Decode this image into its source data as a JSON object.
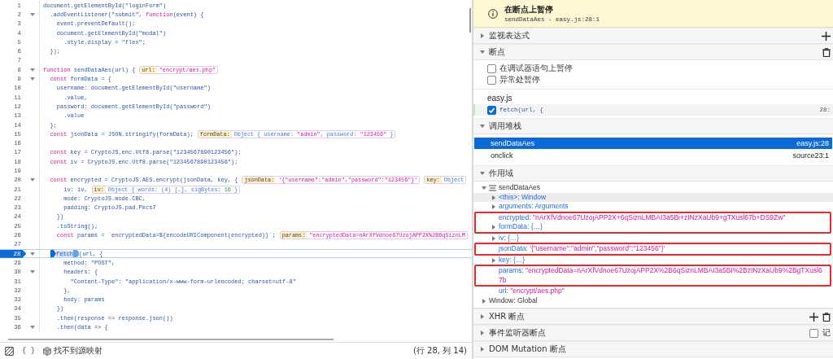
{
  "editor": {
    "lines": [
      {
        "number": "1",
        "fold": false,
        "current": false,
        "code": [
          {
            "kind": "v",
            "text": "document.getElementById(\"loginForm\")"
          }
        ]
      },
      {
        "number": "2",
        "fold": true,
        "current": false,
        "code": [
          {
            "kind": "v",
            "text": "  .addEventListener(\"submit\", "
          },
          {
            "kind": "k",
            "text": "function"
          },
          {
            "kind": "v",
            "text": "(event) {"
          }
        ]
      },
      {
        "number": "3",
        "fold": false,
        "current": false,
        "code": [
          {
            "kind": "v",
            "text": "    event.preventDefault();"
          }
        ]
      },
      {
        "number": "4",
        "fold": false,
        "current": false,
        "code": [
          {
            "kind": "v",
            "text": "    document.getElementById(\"modal\")"
          }
        ]
      },
      {
        "number": "5",
        "fold": false,
        "current": false,
        "code": [
          {
            "kind": "v",
            "text": "      .style.display = \"flex\";"
          }
        ]
      },
      {
        "number": "6",
        "fold": false,
        "current": false,
        "code": [
          {
            "kind": "v",
            "text": "  });"
          }
        ]
      },
      {
        "number": "7",
        "fold": false,
        "current": false
      },
      {
        "number": "8",
        "fold": true,
        "current": false,
        "code": [
          {
            "kind": "k",
            "text": "function "
          },
          {
            "kind": "v",
            "text": "sendDataAes(url) {"
          }
        ],
        "hints": [
          {
            "label": "url:",
            "value": [
              {
                "kind": "hs",
                "text": "\"encrypt/aes.php\""
              }
            ]
          }
        ]
      },
      {
        "number": "9",
        "fold": true,
        "current": false,
        "code": [
          {
            "kind": "k",
            "text": "  const "
          },
          {
            "kind": "v",
            "text": "formData = {"
          }
        ]
      },
      {
        "number": "10",
        "fold": false,
        "current": false,
        "code": [
          {
            "kind": "v",
            "text": "    username: document.getElementById(\"username\")"
          }
        ]
      },
      {
        "number": "11",
        "fold": false,
        "current": false,
        "code": [
          {
            "kind": "v",
            "text": "      .value,"
          }
        ]
      },
      {
        "number": "12",
        "fold": false,
        "current": false,
        "code": [
          {
            "kind": "v",
            "text": "    password: document.getElementById(\"password\")"
          }
        ]
      },
      {
        "number": "13",
        "fold": false,
        "current": false,
        "code": [
          {
            "kind": "v",
            "text": "      .value"
          }
        ]
      },
      {
        "number": "14",
        "fold": false,
        "current": false,
        "code": [
          {
            "kind": "v",
            "text": "  };"
          }
        ]
      },
      {
        "number": "15",
        "fold": false,
        "current": false,
        "code": [
          {
            "kind": "k",
            "text": "  const "
          },
          {
            "kind": "v",
            "text": "jsonData = JSON.stringify(formData);"
          }
        ],
        "hints": [
          {
            "label": "formData:",
            "value": [
              {
                "kind": "hv",
                "text": "Object { username: "
              },
              {
                "kind": "hs",
                "text": "\"admin\""
              },
              {
                "kind": "hv",
                "text": ", password: "
              },
              {
                "kind": "hs",
                "text": "\"123456\""
              },
              {
                "kind": "hv",
                "text": " }"
              }
            ]
          }
        ]
      },
      {
        "number": "16",
        "fold": false,
        "current": false
      },
      {
        "number": "17",
        "fold": false,
        "current": false,
        "code": [
          {
            "kind": "k",
            "text": "  const "
          },
          {
            "kind": "v",
            "text": "key = CryptoJS.enc.Utf8.parse(\"1234567890123456\");"
          }
        ]
      },
      {
        "number": "18",
        "fold": false,
        "current": false,
        "code": [
          {
            "kind": "k",
            "text": "  const "
          },
          {
            "kind": "v",
            "text": "iv = CryptoJS.enc.Utf8.parse(\"1234567890123456\");"
          }
        ]
      },
      {
        "number": "19",
        "fold": false,
        "current": false
      },
      {
        "number": "20",
        "fold": true,
        "current": false,
        "code": [
          {
            "kind": "k",
            "text": "  const "
          },
          {
            "kind": "v",
            "text": "encrypted = CryptoJS.AES.encrypt(jsonData, key, {"
          }
        ],
        "hints": [
          {
            "label": "jsonData:",
            "value": [
              {
                "kind": "hs",
                "text": "'{\"username\":\"admin\",\"password\":\"123456\"}'"
              }
            ]
          },
          {
            "label": "key:",
            "value": [
              {
                "kind": "hv",
                "text": "Object"
              }
            ]
          }
        ]
      },
      {
        "number": "21",
        "fold": false,
        "current": false,
        "code": [
          {
            "kind": "v",
            "text": "      iv: iv,"
          }
        ],
        "hints": [
          {
            "label": "iv:",
            "value": [
              {
                "kind": "hv",
                "text": "Object { words: (4) […], sigBytes: "
              },
              {
                "kind": "hn",
                "text": "16"
              },
              {
                "kind": "hv",
                "text": " }"
              }
            ]
          }
        ]
      },
      {
        "number": "22",
        "fold": false,
        "current": false,
        "code": [
          {
            "kind": "v",
            "text": "      mode: CryptoJS.mode.CBC,"
          }
        ]
      },
      {
        "number": "23",
        "fold": false,
        "current": false,
        "code": [
          {
            "kind": "v",
            "text": "      padding: CryptoJS.pad.Pkcs7"
          }
        ]
      },
      {
        "number": "24",
        "fold": false,
        "current": false,
        "code": [
          {
            "kind": "v",
            "text": "    })"
          }
        ]
      },
      {
        "number": "25",
        "fold": false,
        "current": false,
        "code": [
          {
            "kind": "v",
            "text": "    .toString();"
          }
        ]
      },
      {
        "number": "26",
        "fold": false,
        "current": false,
        "code": [
          {
            "kind": "k",
            "text": "    const "
          },
          {
            "kind": "v",
            "text": "params = `encryptedData=${encodeURIComponent(encrypted)}`;"
          }
        ],
        "hints": [
          {
            "label": "params:",
            "value": [
              {
                "kind": "hs",
                "text": "\"encryptedData=nArXfVdnoe67UzojAPP2X%2B6qSiznLM"
              }
            ]
          }
        ]
      },
      {
        "number": "27",
        "fold": false,
        "current": false
      },
      {
        "number": "28",
        "fold": true,
        "current": true,
        "code": [
          {
            "kind": "bp",
            "text": "fetch"
          },
          {
            "kind": "v",
            "text": "(url, {"
          }
        ]
      },
      {
        "number": "29",
        "fold": false,
        "current": false,
        "code": [
          {
            "kind": "v",
            "text": "      method: \"POST\","
          }
        ]
      },
      {
        "number": "30",
        "fold": true,
        "current": false,
        "code": [
          {
            "kind": "v",
            "text": "      headers: {"
          }
        ]
      },
      {
        "number": "31",
        "fold": false,
        "current": false,
        "code": [
          {
            "kind": "v",
            "text": "        \"Content-Type\": \"application/x-www-form-urlencoded; charset=utf-8\""
          }
        ]
      },
      {
        "number": "32",
        "fold": false,
        "current": false,
        "code": [
          {
            "kind": "v",
            "text": "      },"
          }
        ]
      },
      {
        "number": "33",
        "fold": false,
        "current": false,
        "code": [
          {
            "kind": "v",
            "text": "      body: params"
          }
        ]
      },
      {
        "number": "34",
        "fold": false,
        "current": false,
        "code": [
          {
            "kind": "v",
            "text": "    })"
          }
        ]
      },
      {
        "number": "35",
        "fold": false,
        "current": false,
        "code": [
          {
            "kind": "v",
            "text": "    .then(response => response.json())"
          }
        ]
      },
      {
        "number": "36",
        "fold": true,
        "current": false,
        "code": [
          {
            "kind": "v",
            "text": "    .then(data => {"
          }
        ]
      }
    ]
  },
  "status_bar": {
    "format_label": "{ }",
    "source_map": "找不到源映射",
    "position": "(行 28, 列 14)"
  },
  "pause_banner": {
    "title": "在断点上暂停",
    "location": "sendDataAes - easy.js:28:1"
  },
  "sections": [
    {
      "kind": "watch",
      "title": "监视表达式",
      "expanded": false
    },
    {
      "kind": "breakpoints",
      "title": "断点",
      "expanded": true,
      "options": [
        {
          "label": "在调试器语句上暂停",
          "checked": false
        },
        {
          "label": "异常处暂停",
          "checked": false
        }
      ],
      "files": [
        {
          "name": "easy.js",
          "breakpoints": [
            {
              "code": "fetch(url, {",
              "location": "28:",
              "checked": true
            }
          ]
        }
      ]
    },
    {
      "kind": "call_stack",
      "title": "调用堆栈",
      "expanded": true,
      "frames": [
        {
          "name": "sendDataAes",
          "location": "easy.js:28",
          "selected": true
        },
        {
          "name": "onclick",
          "location": "source23:1",
          "selected": false
        }
      ]
    },
    {
      "kind": "scopes",
      "title": "作用域",
      "expanded": true,
      "tree": [
        {
          "label": "sendDataAes",
          "expanded": true,
          "children": [
            {
              "name": "<this>:",
              "value": "Window",
              "kind": "object",
              "selected": true,
              "boxed": false
            },
            {
              "name": "arguments:",
              "value": "Arguments",
              "kind": "object",
              "selected": false,
              "boxed": false
            },
            {
              "name": "encrypted:",
              "value": "\"nArXfVdnoe67UzojAPP2X+6qSiznLMBAI3a5Bi+zINzXaUb9+gTXusl67b+DS9Zw\"",
              "kind": "string",
              "selected": false,
              "boxed": true
            },
            {
              "name": "formData:",
              "value": "{…}",
              "kind": "object",
              "selected": false,
              "boxed": true
            },
            {
              "name": "iv:",
              "value": "{…}",
              "kind": "object",
              "selected": false,
              "boxed": false
            },
            {
              "name": "jsonData:",
              "value": "'{\"username\":\"admin\",\"password\":\"123456\"}'",
              "kind": "string",
              "selected": false,
              "boxed": true
            },
            {
              "name": "key:",
              "value": "{…}",
              "kind": "object",
              "selected": false,
              "boxed": false
            },
            {
              "name": "params:",
              "value": "\"encryptedData=nArXfVdnoe67UzojAPP2X%2B6qSiznLMBAI3a5BI%2BzINzXaUb9%2BgTXusl67b",
              "kind": "string",
              "selected": false,
              "boxed": true
            },
            {
              "name": "url:",
              "value": "\"encrypt/aes.php\"",
              "kind": "string",
              "selected": false,
              "boxed": false
            }
          ]
        },
        {
          "label": "Window: Global",
          "expanded": false
        }
      ]
    },
    {
      "kind": "xhr",
      "title": "XHR 断点",
      "expanded": false
    },
    {
      "kind": "events",
      "title": "事件监听器断点",
      "expanded": false,
      "log_label": "记",
      "log_checked": false
    },
    {
      "kind": "dom",
      "title": "DOM Mutation 断点",
      "expanded": false
    }
  ]
}
